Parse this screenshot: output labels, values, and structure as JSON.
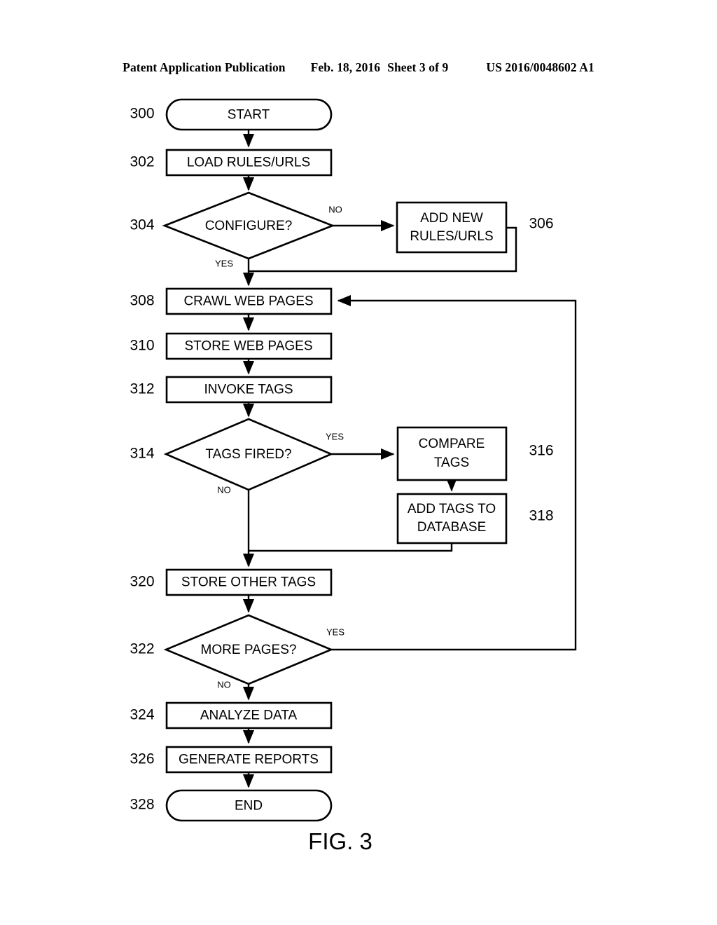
{
  "document": {
    "header": {
      "publication": "Patent Application Publication",
      "date": "Feb. 18, 2016",
      "sheet": "Sheet 3 of 9",
      "pub_number": "US 2016/0048602 A1"
    },
    "figure_caption": "FIG. 3"
  },
  "chart_data": {
    "type": "diagram",
    "title": "FIG. 3",
    "nodes": [
      {
        "ref": "300",
        "label": "START",
        "shape": "terminator"
      },
      {
        "ref": "302",
        "label": "LOAD RULES/URLS",
        "shape": "process"
      },
      {
        "ref": "304",
        "label": "CONFIGURE?",
        "shape": "decision"
      },
      {
        "ref": "306",
        "label": "ADD NEW RULES/URLS",
        "shape": "process",
        "line1": "ADD NEW",
        "line2": "RULES/URLS"
      },
      {
        "ref": "308",
        "label": "CRAWL WEB PAGES",
        "shape": "process"
      },
      {
        "ref": "310",
        "label": "STORE WEB PAGES",
        "shape": "process"
      },
      {
        "ref": "312",
        "label": "INVOKE TAGS",
        "shape": "process"
      },
      {
        "ref": "314",
        "label": "TAGS FIRED?",
        "shape": "decision"
      },
      {
        "ref": "316",
        "label": "COMPARE TAGS",
        "shape": "process",
        "line1": "COMPARE",
        "line2": "TAGS"
      },
      {
        "ref": "318",
        "label": "ADD TAGS TO DATABASE",
        "shape": "process",
        "line1": "ADD TAGS TO",
        "line2": "DATABASE"
      },
      {
        "ref": "320",
        "label": "STORE OTHER TAGS",
        "shape": "process"
      },
      {
        "ref": "322",
        "label": "MORE PAGES?",
        "shape": "decision"
      },
      {
        "ref": "324",
        "label": "ANALYZE DATA",
        "shape": "process"
      },
      {
        "ref": "326",
        "label": "GENERATE REPORTS",
        "shape": "process"
      },
      {
        "ref": "328",
        "label": "END",
        "shape": "terminator"
      }
    ],
    "edges": [
      {
        "from": "300",
        "to": "302",
        "label": ""
      },
      {
        "from": "302",
        "to": "304",
        "label": ""
      },
      {
        "from": "304",
        "to": "306",
        "label": "NO"
      },
      {
        "from": "304",
        "to": "308",
        "label": "YES"
      },
      {
        "from": "306",
        "to": "308",
        "label": ""
      },
      {
        "from": "308",
        "to": "310",
        "label": ""
      },
      {
        "from": "310",
        "to": "312",
        "label": ""
      },
      {
        "from": "312",
        "to": "314",
        "label": ""
      },
      {
        "from": "314",
        "to": "316",
        "label": "YES"
      },
      {
        "from": "314",
        "to": "320",
        "label": "NO"
      },
      {
        "from": "316",
        "to": "318",
        "label": ""
      },
      {
        "from": "318",
        "to": "320",
        "label": ""
      },
      {
        "from": "320",
        "to": "322",
        "label": ""
      },
      {
        "from": "322",
        "to": "308",
        "label": "YES"
      },
      {
        "from": "322",
        "to": "324",
        "label": "NO"
      },
      {
        "from": "324",
        "to": "326",
        "label": ""
      },
      {
        "from": "326",
        "to": "328",
        "label": ""
      }
    ],
    "branch_labels": {
      "configure_no": "NO",
      "configure_yes": "YES",
      "tags_fired_yes": "YES",
      "tags_fired_no": "NO",
      "more_pages_yes": "YES",
      "more_pages_no": "NO"
    },
    "colors": {
      "stroke": "#000000",
      "fill": "#ffffff",
      "background": "#ffffff"
    }
  }
}
